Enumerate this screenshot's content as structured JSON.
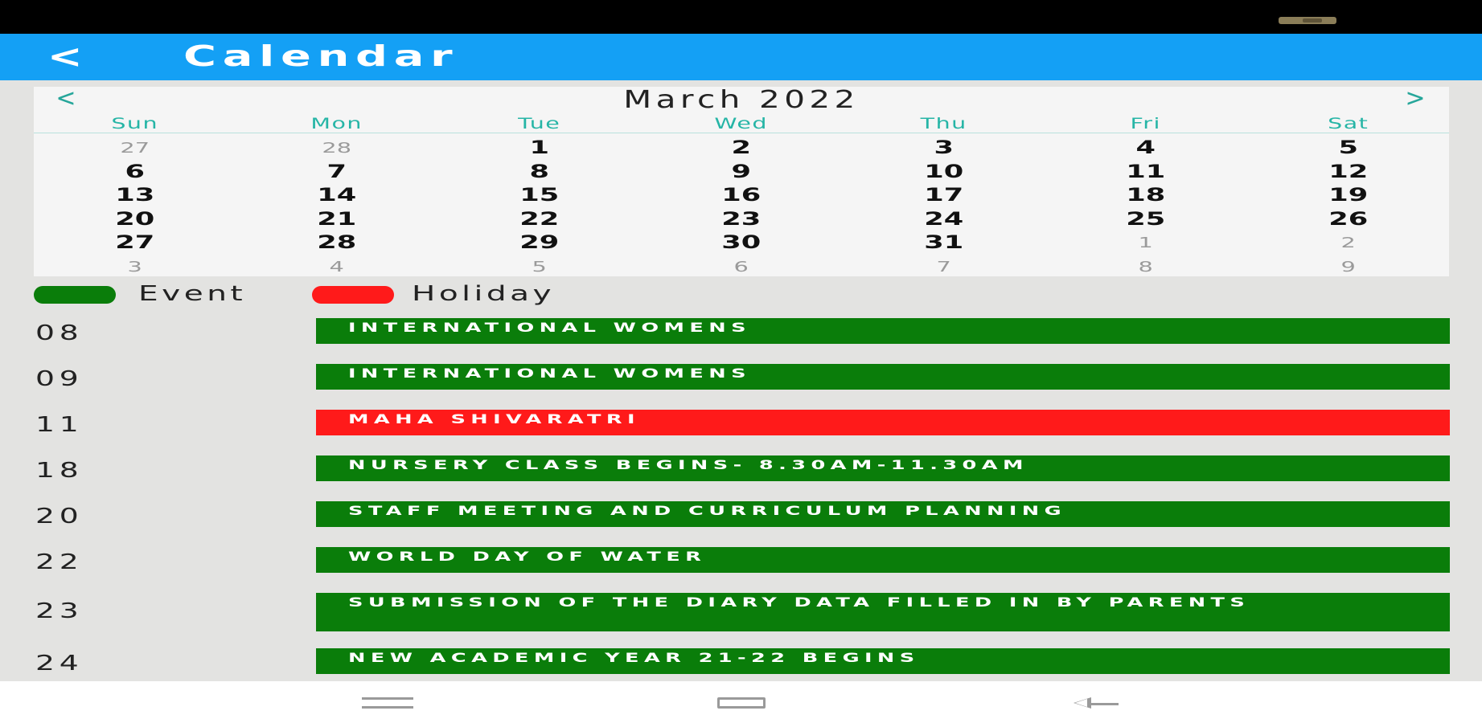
{
  "app_bar": {
    "back_glyph": "<",
    "title": "Calendar"
  },
  "calendar": {
    "month_title": "March 2022",
    "prev_glyph": "<",
    "next_glyph": ">",
    "accent_color": "#26a69a",
    "weekdays": [
      "Sun",
      "Mon",
      "Tue",
      "Wed",
      "Thu",
      "Fri",
      "Sat"
    ],
    "weeks": [
      [
        {
          "d": "27",
          "m": true
        },
        {
          "d": "28",
          "m": true
        },
        {
          "d": "1"
        },
        {
          "d": "2"
        },
        {
          "d": "3"
        },
        {
          "d": "4"
        },
        {
          "d": "5"
        }
      ],
      [
        {
          "d": "6"
        },
        {
          "d": "7"
        },
        {
          "d": "8"
        },
        {
          "d": "9"
        },
        {
          "d": "10"
        },
        {
          "d": "11"
        },
        {
          "d": "12"
        }
      ],
      [
        {
          "d": "13"
        },
        {
          "d": "14"
        },
        {
          "d": "15"
        },
        {
          "d": "16"
        },
        {
          "d": "17"
        },
        {
          "d": "18"
        },
        {
          "d": "19"
        }
      ],
      [
        {
          "d": "20"
        },
        {
          "d": "21"
        },
        {
          "d": "22"
        },
        {
          "d": "23"
        },
        {
          "d": "24"
        },
        {
          "d": "25"
        },
        {
          "d": "26"
        }
      ],
      [
        {
          "d": "27"
        },
        {
          "d": "28"
        },
        {
          "d": "29"
        },
        {
          "d": "30"
        },
        {
          "d": "31"
        },
        {
          "d": "1",
          "m": true
        },
        {
          "d": "2",
          "m": true
        }
      ],
      [
        {
          "d": "3",
          "m": true
        },
        {
          "d": "4",
          "m": true
        },
        {
          "d": "5",
          "m": true
        },
        {
          "d": "6",
          "m": true
        },
        {
          "d": "7",
          "m": true
        },
        {
          "d": "8",
          "m": true
        },
        {
          "d": "9",
          "m": true
        }
      ]
    ]
  },
  "legend": {
    "event_label": "Event",
    "event_color": "#0a7d0a",
    "holiday_label": "Holiday",
    "holiday_color": "#ff1a1a"
  },
  "events": [
    {
      "date": "08",
      "title": "INTERNATIONAL WOMENS",
      "kind": "event"
    },
    {
      "date": "09",
      "title": "INTERNATIONAL WOMENS",
      "kind": "event"
    },
    {
      "date": "11",
      "title": "MAHA SHIVARATRI",
      "kind": "holiday"
    },
    {
      "date": "18",
      "title": "NURSERY CLASS BEGINS- 8.30AM-11.30AM",
      "kind": "event"
    },
    {
      "date": "20",
      "title": "STAFF MEETING AND CURRICULUM PLANNING",
      "kind": "event"
    },
    {
      "date": "22",
      "title": "WORLD DAY OF WATER",
      "kind": "event"
    },
    {
      "date": "23",
      "title": "SUBMISSION OF THE DIARY DATA FILLED IN BY PARENTS",
      "kind": "event"
    },
    {
      "date": "24",
      "title": "NEW ACADEMIC YEAR 21-22 BEGINS",
      "kind": "event"
    }
  ],
  "system_nav": {
    "icons": [
      "menu-icon",
      "home-icon",
      "back-icon"
    ]
  }
}
